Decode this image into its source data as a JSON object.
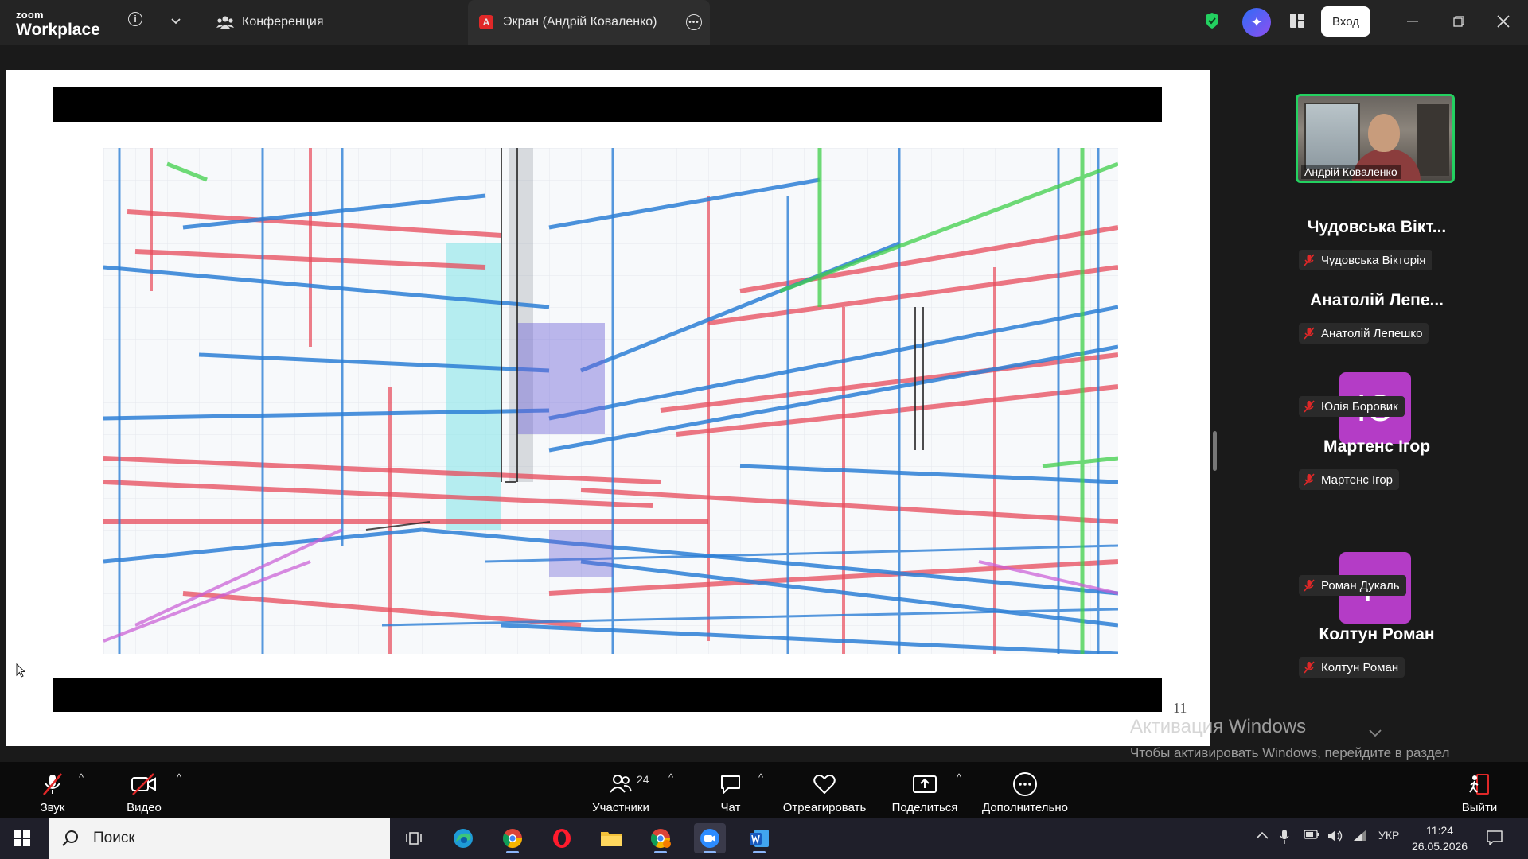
{
  "app": {
    "logo_small": "zoom",
    "logo_big": "Workplace"
  },
  "tabs": [
    {
      "label": "Конференция"
    },
    {
      "label": "Экран (Андрій Коваленко)",
      "badge": "A"
    }
  ],
  "header": {
    "login_label": "Вход"
  },
  "slide": {
    "page_number": "11"
  },
  "participants": {
    "self_camera_name": "Андрій Коваленко",
    "list": [
      {
        "display": "Чудовська Вікт...",
        "tag": "Чудовська Вікторія",
        "avatar": ""
      },
      {
        "display": "Анатолій Лепе...",
        "tag": "Анатолій Лепешко",
        "avatar": ""
      },
      {
        "display": "",
        "tag": "Юлія Боровик",
        "avatar": "Ю"
      },
      {
        "display": "Мартенс Ігор",
        "tag": "Мартенс Ігор",
        "avatar": ""
      },
      {
        "display": "",
        "tag": "Роман Дукаль",
        "avatar": "Р"
      },
      {
        "display": "Колтун Роман",
        "tag": "Колтун Роман",
        "avatar": ""
      }
    ]
  },
  "watermark": {
    "title": "Активация Windows",
    "text": "Чтобы активировать Windows, перейдите в раздел \"Параметры\"."
  },
  "controls": {
    "audio": "Звук",
    "video": "Видео",
    "participants": "Участники",
    "participants_count": "24",
    "chat": "Чат",
    "react": "Отреагировать",
    "share": "Поделиться",
    "more": "Дополнительно",
    "leave": "Выйти"
  },
  "taskbar": {
    "search_placeholder": "Поиск",
    "language": "УКР",
    "time": "11:24",
    "date": "26.05.2026"
  },
  "colors": {
    "accent_green": "#23d160",
    "avatar_purple": "#b43cc6",
    "leave_red": "#e02828",
    "topbar_bg": "#242424"
  }
}
